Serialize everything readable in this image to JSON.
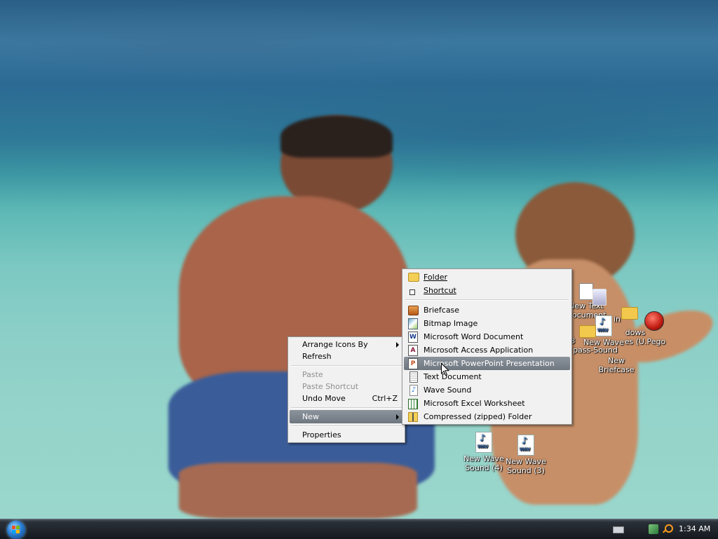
{
  "context_menu": {
    "items": [
      {
        "label": "Arrange Icons By",
        "has_submenu": true
      },
      {
        "label": "Refresh"
      },
      {
        "label": "Paste",
        "disabled": true
      },
      {
        "label": "Paste Shortcut",
        "disabled": true
      },
      {
        "label": "Undo Move",
        "shortcut": "Ctrl+Z"
      },
      {
        "label": "New",
        "has_submenu": true,
        "highlighted": true
      },
      {
        "label": "Properties"
      }
    ]
  },
  "new_submenu": {
    "items": [
      {
        "label": "Folder",
        "icon": "folder-icon"
      },
      {
        "label": "Shortcut",
        "icon": "shortcut-icon"
      },
      {
        "label": "Briefcase",
        "icon": "briefcase-icon"
      },
      {
        "label": "Bitmap Image",
        "icon": "bitmap-icon"
      },
      {
        "label": "Microsoft Word Document",
        "icon": "word-icon"
      },
      {
        "label": "Microsoft Access Application",
        "icon": "access-icon"
      },
      {
        "label": "Microsoft PowerPoint Presentation",
        "icon": "powerpoint-icon",
        "highlighted": true
      },
      {
        "label": "Text Document",
        "icon": "text-document-icon"
      },
      {
        "label": "Wave Sound",
        "icon": "wave-sound-icon"
      },
      {
        "label": "Microsoft Excel Worksheet",
        "icon": "excel-icon"
      },
      {
        "label": "Compressed (zipped) Folder",
        "icon": "zip-folder-icon"
      }
    ]
  },
  "desktop_icons": {
    "wave4_line1": "New Wave",
    "wave4_line2": "Sound (4)",
    "wave3_line1": "New Wave",
    "wave3_line2": "Sound (3)",
    "partial_new_text": "New Text",
    "partial_document": "Document",
    "partial_new_wave": "New Wave",
    "partial_pass_sound": "pass-Sound",
    "partial_windows": "dows",
    "partial_pego": "es (U.Pego",
    "partial_num": "3",
    "partial_in": "in",
    "new_briefcase": "New Briefcase"
  },
  "taskbar": {
    "clock": "1:34 AM"
  },
  "colors": {
    "menu_bg": "#f1f1f1",
    "highlight": "#7a828b",
    "taskbar": "#1b2026"
  }
}
